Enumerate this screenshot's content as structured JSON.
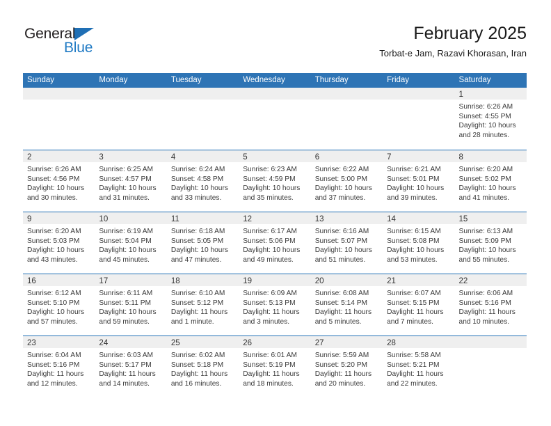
{
  "brand": {
    "name_part1": "General",
    "name_part2": "Blue",
    "triangle_icon": "triangle-icon",
    "accent_color": "#1f7ac4"
  },
  "header": {
    "title": "February 2025",
    "subtitle": "Torbat-e Jam, Razavi Khorasan, Iran"
  },
  "colors": {
    "header_blue": "#2e74b5",
    "row_divider_blue": "#1f6fb5",
    "day_band_gray": "#efefef"
  },
  "weekdays": [
    "Sunday",
    "Monday",
    "Tuesday",
    "Wednesday",
    "Thursday",
    "Friday",
    "Saturday"
  ],
  "weeks": [
    [
      {
        "day": "",
        "sunrise": "",
        "sunset": "",
        "daylight": "",
        "empty": true
      },
      {
        "day": "",
        "sunrise": "",
        "sunset": "",
        "daylight": "",
        "empty": true
      },
      {
        "day": "",
        "sunrise": "",
        "sunset": "",
        "daylight": "",
        "empty": true
      },
      {
        "day": "",
        "sunrise": "",
        "sunset": "",
        "daylight": "",
        "empty": true
      },
      {
        "day": "",
        "sunrise": "",
        "sunset": "",
        "daylight": "",
        "empty": true
      },
      {
        "day": "",
        "sunrise": "",
        "sunset": "",
        "daylight": "",
        "empty": true
      },
      {
        "day": "1",
        "sunrise": "Sunrise: 6:26 AM",
        "sunset": "Sunset: 4:55 PM",
        "daylight": "Daylight: 10 hours and 28 minutes.",
        "empty": false
      }
    ],
    [
      {
        "day": "2",
        "sunrise": "Sunrise: 6:26 AM",
        "sunset": "Sunset: 4:56 PM",
        "daylight": "Daylight: 10 hours and 30 minutes.",
        "empty": false
      },
      {
        "day": "3",
        "sunrise": "Sunrise: 6:25 AM",
        "sunset": "Sunset: 4:57 PM",
        "daylight": "Daylight: 10 hours and 31 minutes.",
        "empty": false
      },
      {
        "day": "4",
        "sunrise": "Sunrise: 6:24 AM",
        "sunset": "Sunset: 4:58 PM",
        "daylight": "Daylight: 10 hours and 33 minutes.",
        "empty": false
      },
      {
        "day": "5",
        "sunrise": "Sunrise: 6:23 AM",
        "sunset": "Sunset: 4:59 PM",
        "daylight": "Daylight: 10 hours and 35 minutes.",
        "empty": false
      },
      {
        "day": "6",
        "sunrise": "Sunrise: 6:22 AM",
        "sunset": "Sunset: 5:00 PM",
        "daylight": "Daylight: 10 hours and 37 minutes.",
        "empty": false
      },
      {
        "day": "7",
        "sunrise": "Sunrise: 6:21 AM",
        "sunset": "Sunset: 5:01 PM",
        "daylight": "Daylight: 10 hours and 39 minutes.",
        "empty": false
      },
      {
        "day": "8",
        "sunrise": "Sunrise: 6:20 AM",
        "sunset": "Sunset: 5:02 PM",
        "daylight": "Daylight: 10 hours and 41 minutes.",
        "empty": false
      }
    ],
    [
      {
        "day": "9",
        "sunrise": "Sunrise: 6:20 AM",
        "sunset": "Sunset: 5:03 PM",
        "daylight": "Daylight: 10 hours and 43 minutes.",
        "empty": false
      },
      {
        "day": "10",
        "sunrise": "Sunrise: 6:19 AM",
        "sunset": "Sunset: 5:04 PM",
        "daylight": "Daylight: 10 hours and 45 minutes.",
        "empty": false
      },
      {
        "day": "11",
        "sunrise": "Sunrise: 6:18 AM",
        "sunset": "Sunset: 5:05 PM",
        "daylight": "Daylight: 10 hours and 47 minutes.",
        "empty": false
      },
      {
        "day": "12",
        "sunrise": "Sunrise: 6:17 AM",
        "sunset": "Sunset: 5:06 PM",
        "daylight": "Daylight: 10 hours and 49 minutes.",
        "empty": false
      },
      {
        "day": "13",
        "sunrise": "Sunrise: 6:16 AM",
        "sunset": "Sunset: 5:07 PM",
        "daylight": "Daylight: 10 hours and 51 minutes.",
        "empty": false
      },
      {
        "day": "14",
        "sunrise": "Sunrise: 6:15 AM",
        "sunset": "Sunset: 5:08 PM",
        "daylight": "Daylight: 10 hours and 53 minutes.",
        "empty": false
      },
      {
        "day": "15",
        "sunrise": "Sunrise: 6:13 AM",
        "sunset": "Sunset: 5:09 PM",
        "daylight": "Daylight: 10 hours and 55 minutes.",
        "empty": false
      }
    ],
    [
      {
        "day": "16",
        "sunrise": "Sunrise: 6:12 AM",
        "sunset": "Sunset: 5:10 PM",
        "daylight": "Daylight: 10 hours and 57 minutes.",
        "empty": false
      },
      {
        "day": "17",
        "sunrise": "Sunrise: 6:11 AM",
        "sunset": "Sunset: 5:11 PM",
        "daylight": "Daylight: 10 hours and 59 minutes.",
        "empty": false
      },
      {
        "day": "18",
        "sunrise": "Sunrise: 6:10 AM",
        "sunset": "Sunset: 5:12 PM",
        "daylight": "Daylight: 11 hours and 1 minute.",
        "empty": false
      },
      {
        "day": "19",
        "sunrise": "Sunrise: 6:09 AM",
        "sunset": "Sunset: 5:13 PM",
        "daylight": "Daylight: 11 hours and 3 minutes.",
        "empty": false
      },
      {
        "day": "20",
        "sunrise": "Sunrise: 6:08 AM",
        "sunset": "Sunset: 5:14 PM",
        "daylight": "Daylight: 11 hours and 5 minutes.",
        "empty": false
      },
      {
        "day": "21",
        "sunrise": "Sunrise: 6:07 AM",
        "sunset": "Sunset: 5:15 PM",
        "daylight": "Daylight: 11 hours and 7 minutes.",
        "empty": false
      },
      {
        "day": "22",
        "sunrise": "Sunrise: 6:06 AM",
        "sunset": "Sunset: 5:16 PM",
        "daylight": "Daylight: 11 hours and 10 minutes.",
        "empty": false
      }
    ],
    [
      {
        "day": "23",
        "sunrise": "Sunrise: 6:04 AM",
        "sunset": "Sunset: 5:16 PM",
        "daylight": "Daylight: 11 hours and 12 minutes.",
        "empty": false
      },
      {
        "day": "24",
        "sunrise": "Sunrise: 6:03 AM",
        "sunset": "Sunset: 5:17 PM",
        "daylight": "Daylight: 11 hours and 14 minutes.",
        "empty": false
      },
      {
        "day": "25",
        "sunrise": "Sunrise: 6:02 AM",
        "sunset": "Sunset: 5:18 PM",
        "daylight": "Daylight: 11 hours and 16 minutes.",
        "empty": false
      },
      {
        "day": "26",
        "sunrise": "Sunrise: 6:01 AM",
        "sunset": "Sunset: 5:19 PM",
        "daylight": "Daylight: 11 hours and 18 minutes.",
        "empty": false
      },
      {
        "day": "27",
        "sunrise": "Sunrise: 5:59 AM",
        "sunset": "Sunset: 5:20 PM",
        "daylight": "Daylight: 11 hours and 20 minutes.",
        "empty": false
      },
      {
        "day": "28",
        "sunrise": "Sunrise: 5:58 AM",
        "sunset": "Sunset: 5:21 PM",
        "daylight": "Daylight: 11 hours and 22 minutes.",
        "empty": false
      },
      {
        "day": "",
        "sunrise": "",
        "sunset": "",
        "daylight": "",
        "empty": true
      }
    ]
  ]
}
